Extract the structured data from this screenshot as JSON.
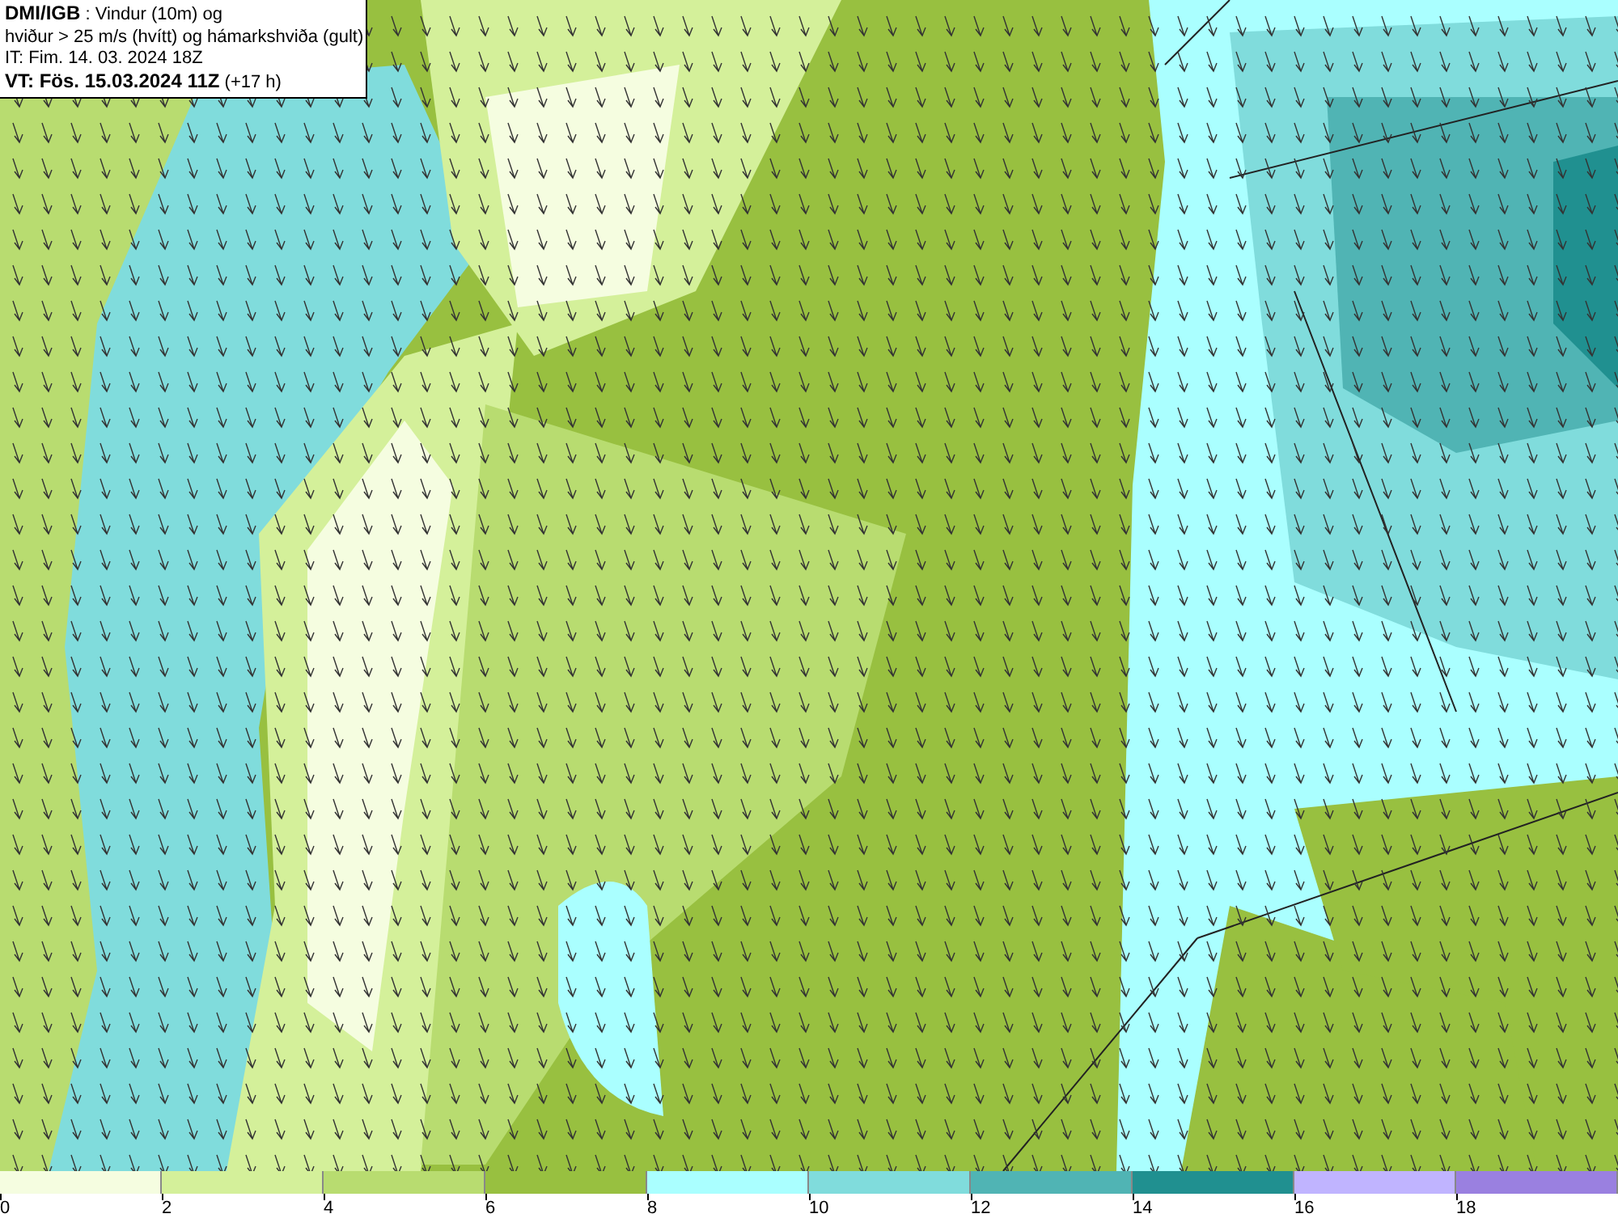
{
  "header": {
    "lines": [
      "**DMI/IGB** : Vindur (10m) og",
      "hviður > 25 m/s (hvítt) og hámarkshviða (gult)",
      "IT: Fim. 14. 03. 2024 18Z",
      "**VT: Fös. 15.03.2024 11Z** (+17 h)"
    ]
  },
  "legend": {
    "bins": [
      {
        "color": "#f5fde0"
      },
      {
        "color": "#d4f09a"
      },
      {
        "color": "#b8dc70"
      },
      {
        "color": "#98c040"
      },
      {
        "color": "#aaffff"
      },
      {
        "color": "#80dcdc"
      },
      {
        "color": "#50b4b4"
      },
      {
        "color": "#209090"
      },
      {
        "color": "#c0b4ff"
      },
      {
        "color": "#9a80e0"
      }
    ],
    "ticks": [
      "0",
      "2",
      "4",
      "6",
      "8",
      "10",
      "12",
      "14",
      "16",
      "18"
    ]
  }
}
